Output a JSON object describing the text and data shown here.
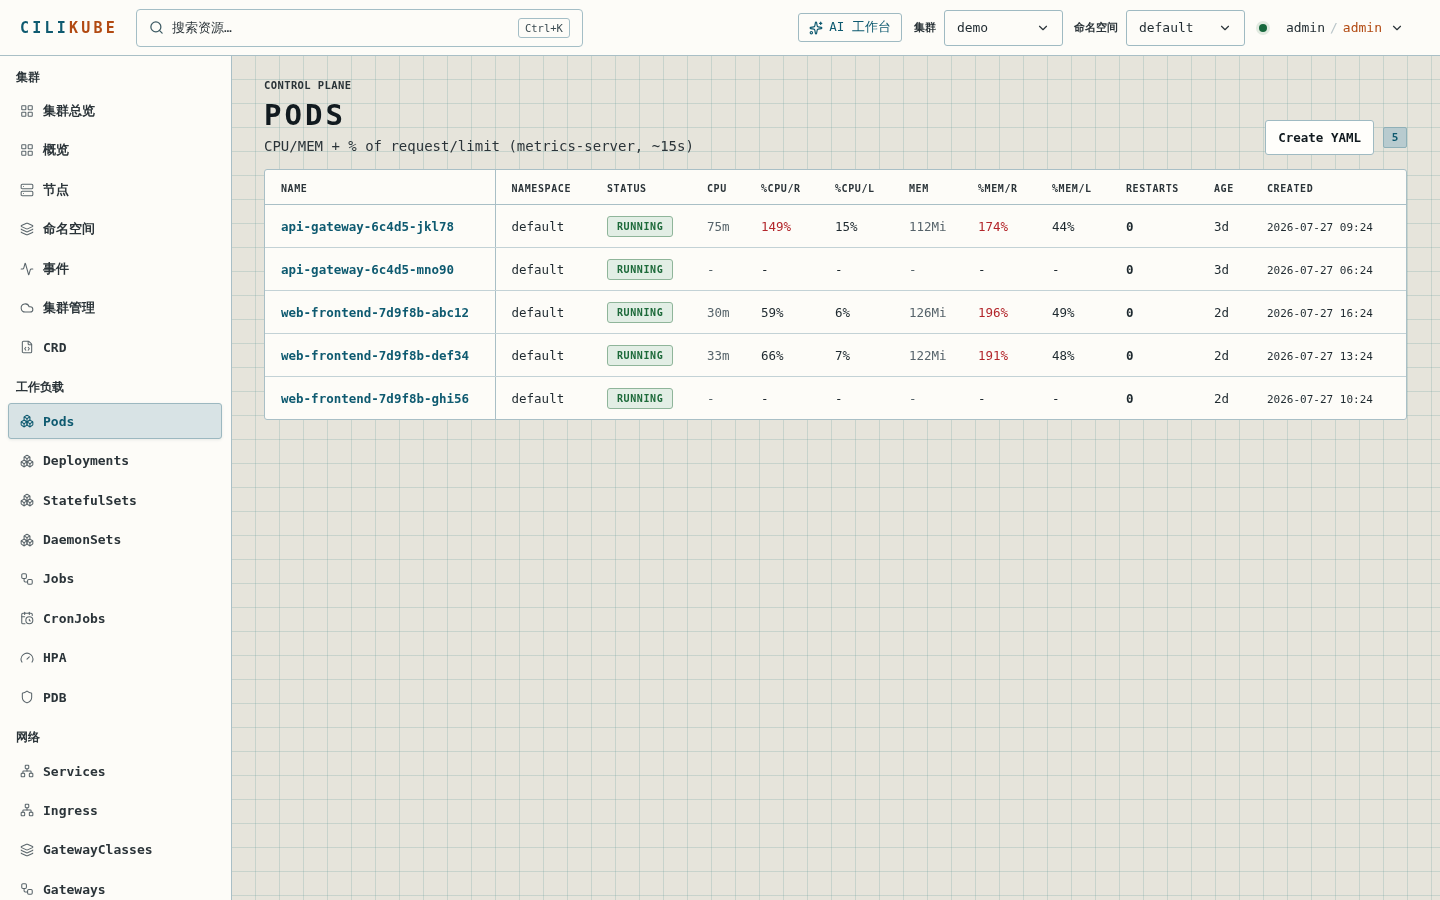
{
  "topbar": {
    "logo": {
      "primary": "CILI",
      "accent": "KUBE"
    },
    "search": {
      "placeholder": "搜索资源…",
      "shortcut": "Ctrl+K"
    },
    "ai_button": "AI 工作台",
    "cluster": {
      "label": "集群",
      "value": "demo"
    },
    "namespace": {
      "label": "命名空间",
      "value": "default"
    },
    "user": {
      "online": true,
      "name": "admin",
      "separator": "/",
      "role": "admin"
    }
  },
  "sidebar": {
    "sections": [
      {
        "title": "集群",
        "items": [
          {
            "label": "集群总览",
            "selected": false
          },
          {
            "label": "概览",
            "selected": false
          },
          {
            "label": "节点",
            "selected": false
          },
          {
            "label": "命名空间",
            "selected": false
          },
          {
            "label": "事件",
            "selected": false
          },
          {
            "label": "集群管理",
            "selected": false
          },
          {
            "label": "CRD",
            "selected": false
          }
        ]
      },
      {
        "title": "工作负载",
        "items": [
          {
            "label": "Pods",
            "selected": true
          },
          {
            "label": "Deployments",
            "selected": false
          },
          {
            "label": "StatefulSets",
            "selected": false
          },
          {
            "label": "DaemonSets",
            "selected": false
          },
          {
            "label": "Jobs",
            "selected": false
          },
          {
            "label": "CronJobs",
            "selected": false
          },
          {
            "label": "HPA",
            "selected": false
          },
          {
            "label": "PDB",
            "selected": false
          }
        ]
      },
      {
        "title": "网络",
        "items": [
          {
            "label": "Services",
            "selected": false
          },
          {
            "label": "Ingress",
            "selected": false
          },
          {
            "label": "GatewayClasses",
            "selected": false
          },
          {
            "label": "Gateways",
            "selected": false
          }
        ]
      }
    ]
  },
  "page": {
    "eyebrow": "CONTROL PLANE",
    "title": "PODS",
    "subtitle": "CPU/MEM + % of request/limit (metrics-server, ~15s)",
    "create_button": "Create YAML",
    "count": "5"
  },
  "table": {
    "columns": [
      "NAME",
      "NAMESPACE",
      "STATUS",
      "CPU",
      "%CPU/R",
      "%CPU/L",
      "MEM",
      "%MEM/R",
      "%MEM/L",
      "RESTARTS",
      "AGE",
      "CREATED"
    ],
    "rows": [
      {
        "name": "api-gateway-6c4d5-jkl78",
        "namespace": "default",
        "status": "RUNNING",
        "cpu": "75m",
        "cpu_request": {
          "text": "149%",
          "over": true
        },
        "cpu_limit": {
          "text": "15%",
          "over": false
        },
        "mem": "112Mi",
        "mem_request": {
          "text": "174%",
          "over": true
        },
        "mem_limit": {
          "text": "44%",
          "over": false
        },
        "restarts": "0",
        "age": "3d",
        "created": "2026-07-27 09:24"
      },
      {
        "name": "api-gateway-6c4d5-mno90",
        "namespace": "default",
        "status": "RUNNING",
        "cpu": "-",
        "cpu_request": {
          "text": "-",
          "over": false
        },
        "cpu_limit": {
          "text": "-",
          "over": false
        },
        "mem": "-",
        "mem_request": {
          "text": "-",
          "over": false
        },
        "mem_limit": {
          "text": "-",
          "over": false
        },
        "restarts": "0",
        "age": "3d",
        "created": "2026-07-27 06:24"
      },
      {
        "name": "web-frontend-7d9f8b-abc12",
        "namespace": "default",
        "status": "RUNNING",
        "cpu": "30m",
        "cpu_request": {
          "text": "59%",
          "over": false
        },
        "cpu_limit": {
          "text": "6%",
          "over": false
        },
        "mem": "126Mi",
        "mem_request": {
          "text": "196%",
          "over": true
        },
        "mem_limit": {
          "text": "49%",
          "over": false
        },
        "restarts": "0",
        "age": "2d",
        "created": "2026-07-27 16:24"
      },
      {
        "name": "web-frontend-7d9f8b-def34",
        "namespace": "default",
        "status": "RUNNING",
        "cpu": "33m",
        "cpu_request": {
          "text": "66%",
          "over": false
        },
        "cpu_limit": {
          "text": "7%",
          "over": false
        },
        "mem": "122Mi",
        "mem_request": {
          "text": "191%",
          "over": true
        },
        "mem_limit": {
          "text": "48%",
          "over": false
        },
        "restarts": "0",
        "age": "2d",
        "created": "2026-07-27 13:24"
      },
      {
        "name": "web-frontend-7d9f8b-ghi56",
        "namespace": "default",
        "status": "RUNNING",
        "cpu": "-",
        "cpu_request": {
          "text": "-",
          "over": false
        },
        "cpu_limit": {
          "text": "-",
          "over": false
        },
        "mem": "-",
        "mem_request": {
          "text": "-",
          "over": false
        },
        "mem_limit": {
          "text": "-",
          "over": false
        },
        "restarts": "0",
        "age": "2d",
        "created": "2026-07-27 10:24"
      }
    ]
  }
}
